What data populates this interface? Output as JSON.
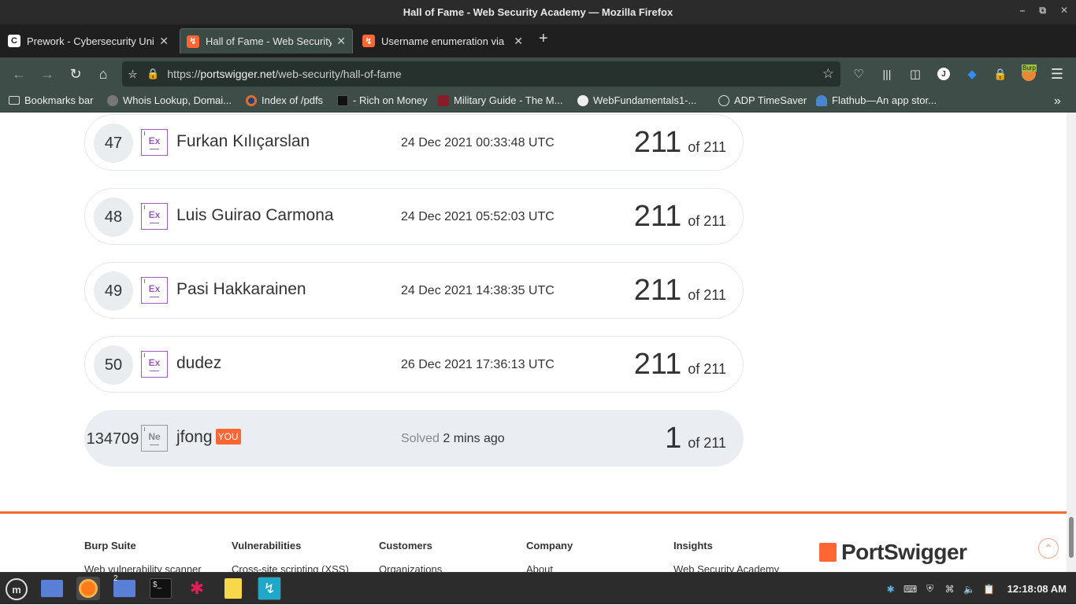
{
  "window": {
    "title": "Hall of Fame - Web Security Academy — Mozilla Firefox"
  },
  "tabs": [
    {
      "title": "Prework - Cybersecurity Uni",
      "icon": "c-icon",
      "active": false
    },
    {
      "title": "Hall of Fame - Web Security",
      "icon": "portswigger-icon",
      "active": true
    },
    {
      "title": "Username enumeration via",
      "icon": "portswigger-icon",
      "active": false
    }
  ],
  "url": {
    "scheme": "https://",
    "host": "portswigger.net",
    "path": "/web-security/hall-of-fame"
  },
  "bookmarks": [
    {
      "label": "Bookmarks bar"
    },
    {
      "label": "Whois Lookup, Domai..."
    },
    {
      "label": "Index of /pdfs"
    },
    {
      "label": "- Rich on Money"
    },
    {
      "label": "Military Guide - The M..."
    },
    {
      "label": "WebFundamentals1-..."
    },
    {
      "label": "ADP TimeSaver"
    },
    {
      "label": "Flathub—An app stor..."
    }
  ],
  "leaderboard": [
    {
      "rank": "47",
      "badge": "Ex",
      "name": "Furkan Kılıçarslan",
      "date": "24 Dec 2021 00:33:48 UTC",
      "score": "211",
      "total": "of 211"
    },
    {
      "rank": "48",
      "badge": "Ex",
      "name": "Luis Guirao Carmona",
      "date": "24 Dec 2021 05:52:03 UTC",
      "score": "211",
      "total": "of 211"
    },
    {
      "rank": "49",
      "badge": "Ex",
      "name": "Pasi Hakkarainen",
      "date": "24 Dec 2021 14:38:35 UTC",
      "score": "211",
      "total": "of 211"
    },
    {
      "rank": "50",
      "badge": "Ex",
      "name": "dudez",
      "date": "26 Dec 2021 17:36:13 UTC",
      "score": "211",
      "total": "of 211"
    }
  ],
  "me": {
    "rank": "134709",
    "badge": "Ne",
    "name": "jfong",
    "you": "YOU",
    "solved_label": "Solved",
    "solved_time": "2 mins ago",
    "score": "1",
    "total": "of 211"
  },
  "footer": {
    "columns": [
      {
        "heading": "Burp Suite",
        "first": "Web vulnerability scanner"
      },
      {
        "heading": "Vulnerabilities",
        "first": "Cross-site scripting (XSS)"
      },
      {
        "heading": "Customers",
        "first": "Organizations"
      },
      {
        "heading": "Company",
        "first": "About"
      },
      {
        "heading": "Insights",
        "first": "Web Security Academy"
      }
    ],
    "logo": "PortSwigger"
  },
  "extension_badge": "Burp",
  "account_initial": "J",
  "taskbar": {
    "clock": "12:18:08 AM",
    "files_badge": "2"
  },
  "colors": {
    "accent": "#ff6633",
    "badge_purple": "#9a5fb9"
  }
}
